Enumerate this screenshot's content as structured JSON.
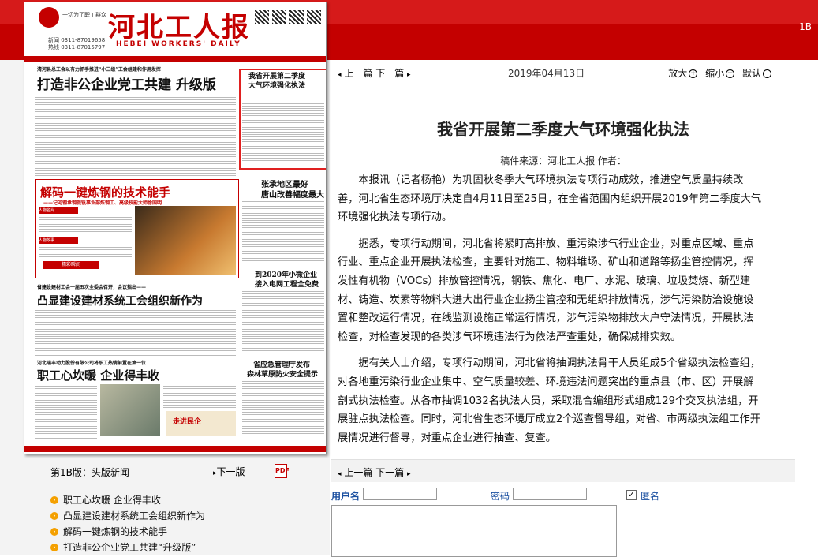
{
  "header": {
    "page_id": "1B"
  },
  "newspaper": {
    "name": "河北工人报",
    "name_en": "HEBEI WORKERS' DAILY",
    "slogan": "一切为了职工群众",
    "phones": [
      "新闻 0311-87019658",
      "热线 0311-87015797"
    ],
    "headlines": {
      "lead_kicker": "清河县总工会以有力抓手推进“小三级”工会组建和作用发挥",
      "lead": "打造非公企业党工共建 升级版",
      "boxed_1": "我省开展第二季度",
      "boxed_2": "大气环境强化执法",
      "zhang_1": "张承地区最好",
      "zhang_2": "唐山改善幅度最大",
      "feature": "解码一键炼钢的技术能手",
      "feature_sub": "——记河钢承钢提钒事业部炼钢工、高级技能大师徐国明",
      "rural_1": "到2020年小微企业",
      "rural_2": "接入电网工程全免费",
      "building_kicker": "省建设建材工会一届五次全委会召开，会议指出——",
      "building": "凸显建设建材系统工会组织新作为",
      "winter_kicker": "河北瑞丰动力股份有限公司将职工热情前置在第一位",
      "winter": "职工心坎暖  企业得丰收",
      "forest_1": "省应急管理厅发布",
      "forest_2": "森林草原防火安全提示",
      "banner": "走进民企",
      "fea_tag1": "人物名片",
      "fea_tag2": "人物故事",
      "fea_tag3": "精彩瞬间"
    }
  },
  "article_nav": {
    "prev": "上一篇",
    "next": "下一篇",
    "date": "2019年04月13日",
    "zoom_in": "放大",
    "zoom_out": "缩小",
    "default": "默认"
  },
  "article": {
    "title": "我省开展第二季度大气环境强化执法",
    "source": "稿件来源：河北工人报  作者：",
    "paragraphs": [
      "本报讯（记者杨艳）为巩固秋冬季大气环境执法专项行动成效，推进空气质量持续改善，河北省生态环境厅决定自4月11日至25日，在全省范围内组织开展2019年第二季度大气环境强化执法专项行动。",
      "据悉，专项行动期间，河北省将紧盯高排放、重污染涉气行业企业，对重点区域、重点行业、重点企业开展执法检查，主要针对施工、物料堆场、矿山和道路等扬尘管控情况，挥发性有机物（VOCs）排放管控情况，钢铁、焦化、电厂、水泥、玻璃、垃圾焚烧、新型建材、铸造、炭素等物料大进大出行业企业扬尘管控和无组织排放情况，涉气污染防治设施设置和整改运行情况，在线监测设施正常运行情况，涉气污染物排放大户守法情况，开展执法检查，对检查发现的各类涉气环境违法行为依法严查重处，确保减排实效。",
      "据有关人士介绍，专项行动期间，河北省将抽调执法骨干人员组成5个省级执法检查组，对各地重污染行业企业集中、空气质量较差、环境违法问题突出的重点县（市、区）开展解剖式执法检查。从各市抽调1032名执法人员，采取混合编组形式组成129个交叉执法组，开展驻点执法检查。同时，河北省生态环境厅成立2个巡查督导组，对省、市两级执法组工作开展情况进行督导，对重点企业进行抽查、复查。"
    ]
  },
  "bottom_nav": {
    "prev": "上一篇",
    "next": "下一篇"
  },
  "comment": {
    "username_label": "用户名",
    "password_label": "密码",
    "anonymous_label": "匿名",
    "username_value": "",
    "password_value": ""
  },
  "page_nav": {
    "version_label": "第1B版：头版新闻",
    "next_version": "下一版",
    "pdf_icon": "PDF"
  },
  "stories": [
    "职工心坎暖 企业得丰收",
    "凸显建设建材系统工会组织新作为",
    "解码一键炼钢的技术能手",
    "打造非公企业党工共建“升级版”"
  ],
  "colors": {
    "brand_red": "#c40000",
    "link_blue": "#1a4fa0",
    "bullet_orange": "#f4a000"
  }
}
